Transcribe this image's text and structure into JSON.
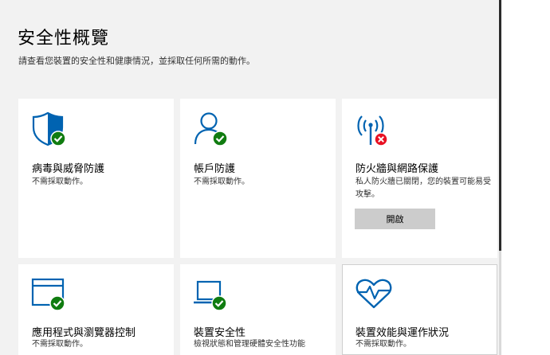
{
  "page": {
    "title": "安全性概覽",
    "subtitle": "請查看您裝置的安全性和健康情況，並採取任何所需的動作。"
  },
  "tiles": [
    {
      "title": "病毒與威脅防護",
      "status": "不需採取動作。",
      "icon": "shield-icon",
      "badge": "ok"
    },
    {
      "title": "帳戶防護",
      "status": "不需採取動作。",
      "icon": "person-icon",
      "badge": "ok"
    },
    {
      "title": "防火牆與網路保護",
      "status": "私人防火牆已關閉，您的裝置可能易受攻擊。",
      "icon": "antenna-icon",
      "badge": "error",
      "button": "開啟"
    },
    {
      "title": "應用程式與瀏覽器控制",
      "status": "不需採取動作。",
      "icon": "browser-window-icon",
      "badge": "ok"
    },
    {
      "title": "裝置安全性",
      "status": "檢視狀態和管理硬體安全性功能",
      "icon": "laptop-icon",
      "badge": "ok"
    },
    {
      "title": "裝置效能與運作狀況",
      "status": "不需採取動作。",
      "icon": "heart-icon",
      "badge": "none"
    }
  ],
  "colors": {
    "accent": "#0063b1",
    "ok": "#107c10",
    "error": "#e81123",
    "button": "#cccccc",
    "background": "#f2f2f2"
  }
}
